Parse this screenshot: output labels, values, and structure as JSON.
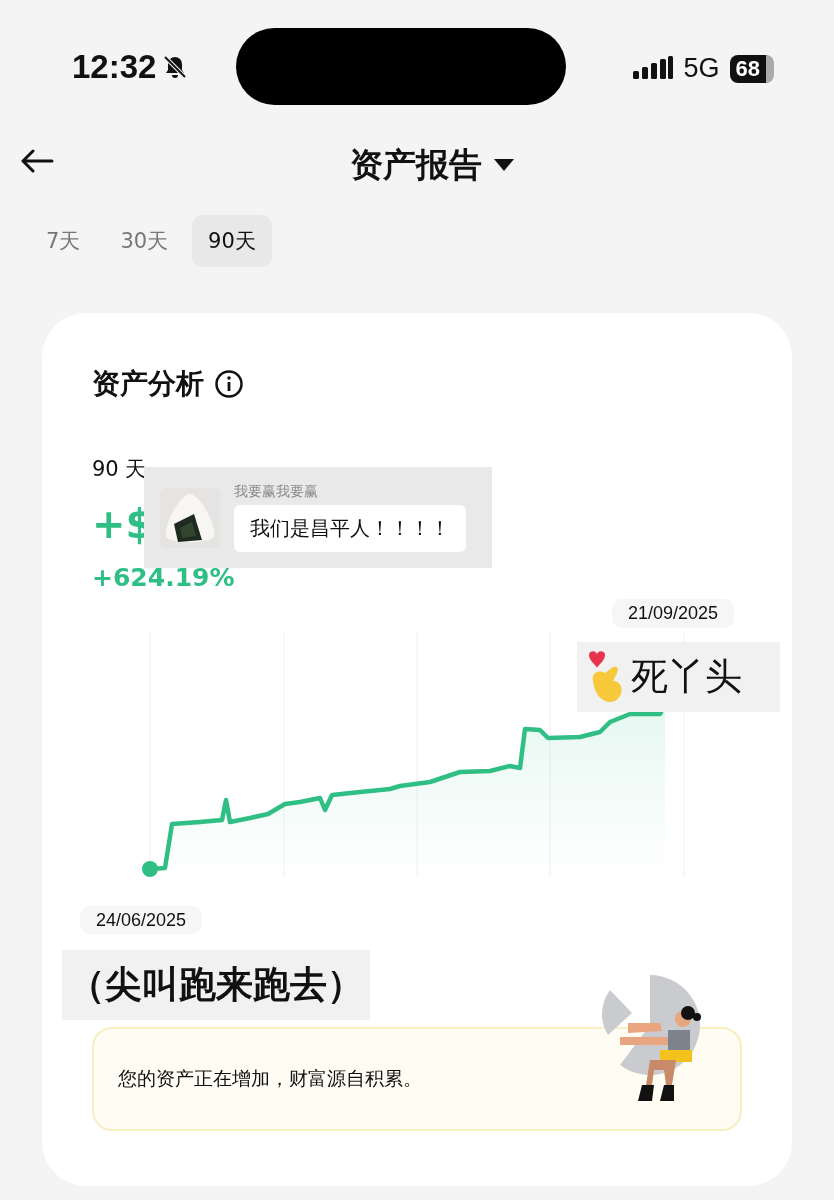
{
  "status_bar": {
    "time": "12:32",
    "network": "5G",
    "battery": "68"
  },
  "header": {
    "title": "资产报告"
  },
  "tabs": [
    {
      "label": "7天",
      "selected": false
    },
    {
      "label": "30天",
      "selected": false
    },
    {
      "label": "90天",
      "selected": true
    }
  ],
  "card": {
    "title": "资产分析",
    "change_label": "90 天",
    "amount": "+$",
    "percent": "+624.19%",
    "start_date": "24/06/2025",
    "end_date": "21/09/2025",
    "message": "您的资产正在增加，财富源自积累。"
  },
  "stickers": [
    {
      "kind": "chat",
      "sender": "我要赢我要赢",
      "text": "我们是昌平人！！！！"
    },
    {
      "kind": "emoji_caption",
      "text": "死丫头"
    },
    {
      "kind": "caption",
      "text": "（尖叫跑来跑去）"
    }
  ]
}
